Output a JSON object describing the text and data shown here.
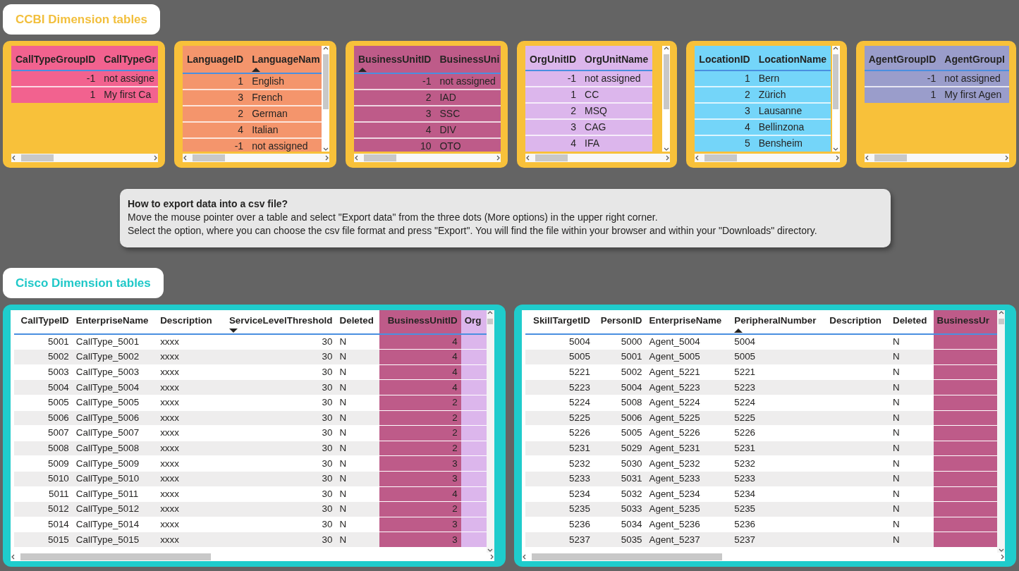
{
  "ccbi_section": {
    "title": "CCBI Dimension tables",
    "tables": [
      {
        "color": "#f2628f",
        "vertical_scrollbar": false,
        "columns": [
          {
            "label": "CallTypeGroupID",
            "numeric": true,
            "sort_ascending": false,
            "sort_descending": false
          },
          {
            "label": "CallTypeGr",
            "numeric": false,
            "sort_ascending": false,
            "sort_descending": false
          }
        ],
        "rows": [
          [
            "-1",
            "not assigne"
          ],
          [
            "1",
            "My first Ca"
          ]
        ]
      },
      {
        "color": "#f4956c",
        "vertical_scrollbar": true,
        "columns": [
          {
            "label": "LanguageID",
            "numeric": true,
            "sort_ascending": false,
            "sort_descending": false
          },
          {
            "label": "LanguageNam",
            "numeric": false,
            "sort_ascending": true,
            "sort_descending": false
          }
        ],
        "rows": [
          [
            "1",
            "English"
          ],
          [
            "3",
            "French"
          ],
          [
            "2",
            "German"
          ],
          [
            "4",
            "Italian"
          ],
          [
            "-1",
            "not assigned"
          ]
        ]
      },
      {
        "color": "#be5b89",
        "vertical_scrollbar": false,
        "columns": [
          {
            "label": "BusinessUnitID",
            "numeric": true,
            "sort_ascending": true,
            "sort_descending": false
          },
          {
            "label": "BusinessUni",
            "numeric": false,
            "sort_ascending": false,
            "sort_descending": false
          }
        ],
        "rows": [
          [
            "-1",
            "not assigned"
          ],
          [
            "2",
            "IAD"
          ],
          [
            "3",
            "SSC"
          ],
          [
            "4",
            "DIV"
          ],
          [
            "10",
            "OTO"
          ]
        ]
      },
      {
        "color": "#dcb6ec",
        "vertical_scrollbar": true,
        "columns": [
          {
            "label": "OrgUnitID",
            "numeric": true,
            "sort_ascending": false,
            "sort_descending": false
          },
          {
            "label": "OrgUnitName",
            "numeric": false,
            "sort_ascending": false,
            "sort_descending": false
          }
        ],
        "rows": [
          [
            "-1",
            "not assigned"
          ],
          [
            "1",
            "CC"
          ],
          [
            "2",
            "MSQ"
          ],
          [
            "3",
            "CAG"
          ],
          [
            "4",
            "IFA"
          ]
        ]
      },
      {
        "color": "#74d5f9",
        "vertical_scrollbar": true,
        "columns": [
          {
            "label": "LocationID",
            "numeric": true,
            "sort_ascending": false,
            "sort_descending": false
          },
          {
            "label": "LocationName",
            "numeric": false,
            "sort_ascending": false,
            "sort_descending": false
          }
        ],
        "rows": [
          [
            "1",
            "Bern"
          ],
          [
            "2",
            "Zürich"
          ],
          [
            "3",
            "Lausanne"
          ],
          [
            "4",
            "Bellinzona"
          ],
          [
            "5",
            "Bensheim"
          ]
        ]
      },
      {
        "color": "#9a9dcb",
        "vertical_scrollbar": false,
        "columns": [
          {
            "label": "AgentGroupID",
            "numeric": true,
            "sort_ascending": false,
            "sort_descending": false
          },
          {
            "label": "AgentGroupI",
            "numeric": false,
            "sort_ascending": false,
            "sort_descending": false
          }
        ],
        "rows": [
          [
            "-1",
            "not assigned"
          ],
          [
            "1",
            "My first Agen"
          ]
        ]
      }
    ]
  },
  "info_box": {
    "heading": "How to export data into a csv file?",
    "lines": [
      "Move the mouse pointer over a table and select \"Export data\" from the three dots (More options) in the upper right corner.",
      "Select the option, where you can choose the csv file format and press \"Export\". You will find the file within your browser and within your \"Downloads\" directory."
    ]
  },
  "cisco_section": {
    "title": "Cisco Dimension tables",
    "tables": [
      {
        "columns": [
          {
            "label": "CallTypeID",
            "numeric": true,
            "sort_ascending": false,
            "sort_descending": false
          },
          {
            "label": "EnterpriseName",
            "numeric": false,
            "sort_ascending": false,
            "sort_descending": false
          },
          {
            "label": "Description",
            "numeric": false,
            "sort_ascending": false,
            "sort_descending": false
          },
          {
            "label": "ServiceLevelThreshold",
            "numeric": true,
            "sort_ascending": false,
            "sort_descending": true
          },
          {
            "label": "Deleted",
            "numeric": false,
            "sort_ascending": false,
            "sort_descending": false
          },
          {
            "label": "BusinessUnitID",
            "numeric": true,
            "sort_ascending": false,
            "sort_descending": false,
            "color": "#be5b89"
          },
          {
            "label": "Org",
            "numeric": false,
            "sort_ascending": false,
            "sort_descending": false,
            "color": "#dcb6ec"
          }
        ],
        "rows": [
          [
            "5001",
            "CallType_5001",
            "xxxx",
            "30",
            "N",
            "4",
            null
          ],
          [
            "5002",
            "CallType_5002",
            "xxxx",
            "30",
            "N",
            "4",
            null
          ],
          [
            "5003",
            "CallType_5003",
            "xxxx",
            "30",
            "N",
            "4",
            null
          ],
          [
            "5004",
            "CallType_5004",
            "xxxx",
            "30",
            "N",
            "4",
            null
          ],
          [
            "5005",
            "CallType_5005",
            "xxxx",
            "30",
            "N",
            "2",
            null
          ],
          [
            "5006",
            "CallType_5006",
            "xxxx",
            "30",
            "N",
            "2",
            null
          ],
          [
            "5007",
            "CallType_5007",
            "xxxx",
            "30",
            "N",
            "2",
            null
          ],
          [
            "5008",
            "CallType_5008",
            "xxxx",
            "30",
            "N",
            "2",
            null
          ],
          [
            "5009",
            "CallType_5009",
            "xxxx",
            "30",
            "N",
            "3",
            null
          ],
          [
            "5010",
            "CallType_5010",
            "xxxx",
            "30",
            "N",
            "3",
            null
          ],
          [
            "5011",
            "CallType_5011",
            "xxxx",
            "30",
            "N",
            "4",
            null
          ],
          [
            "5012",
            "CallType_5012",
            "xxxx",
            "30",
            "N",
            "2",
            null
          ],
          [
            "5014",
            "CallType_5014",
            "xxxx",
            "30",
            "N",
            "3",
            null
          ],
          [
            "5015",
            "CallType_5015",
            "xxxx",
            "30",
            "N",
            "3",
            null
          ]
        ]
      },
      {
        "columns": [
          {
            "label": "SkillTargetID",
            "numeric": true,
            "sort_ascending": false,
            "sort_descending": false
          },
          {
            "label": "PersonID",
            "numeric": true,
            "sort_ascending": false,
            "sort_descending": false
          },
          {
            "label": "EnterpriseName",
            "numeric": false,
            "sort_ascending": false,
            "sort_descending": false
          },
          {
            "label": "PeripheralNumber",
            "numeric": false,
            "sort_ascending": true,
            "sort_descending": false
          },
          {
            "label": "Description",
            "numeric": false,
            "sort_ascending": false,
            "sort_descending": false
          },
          {
            "label": "Deleted",
            "numeric": false,
            "sort_ascending": false,
            "sort_descending": false
          },
          {
            "label": "BusinessUr",
            "numeric": false,
            "sort_ascending": false,
            "sort_descending": false,
            "color": "#be5b89"
          }
        ],
        "rows": [
          [
            "5004",
            "5000",
            "Agent_5004",
            "5004",
            null,
            "N",
            null
          ],
          [
            "5005",
            "5001",
            "Agent_5005",
            "5005",
            null,
            "N",
            null
          ],
          [
            "5221",
            "5002",
            "Agent_5221",
            "5221",
            null,
            "N",
            null
          ],
          [
            "5223",
            "5004",
            "Agent_5223",
            "5223",
            null,
            "N",
            null
          ],
          [
            "5224",
            "5008",
            "Agent_5224",
            "5224",
            null,
            "N",
            null
          ],
          [
            "5225",
            "5006",
            "Agent_5225",
            "5225",
            null,
            "N",
            null
          ],
          [
            "5226",
            "5005",
            "Agent_5226",
            "5226",
            null,
            "N",
            null
          ],
          [
            "5231",
            "5029",
            "Agent_5231",
            "5231",
            null,
            "N",
            null
          ],
          [
            "5232",
            "5030",
            "Agent_5232",
            "5232",
            null,
            "N",
            null
          ],
          [
            "5233",
            "5031",
            "Agent_5233",
            "5233",
            null,
            "N",
            null
          ],
          [
            "5234",
            "5032",
            "Agent_5234",
            "5234",
            null,
            "N",
            null
          ],
          [
            "5235",
            "5033",
            "Agent_5235",
            "5235",
            null,
            "N",
            null
          ],
          [
            "5236",
            "5034",
            "Agent_5236",
            "5236",
            null,
            "N",
            null
          ],
          [
            "5237",
            "5035",
            "Agent_5237",
            "5237",
            null,
            "N",
            null
          ]
        ]
      }
    ]
  }
}
